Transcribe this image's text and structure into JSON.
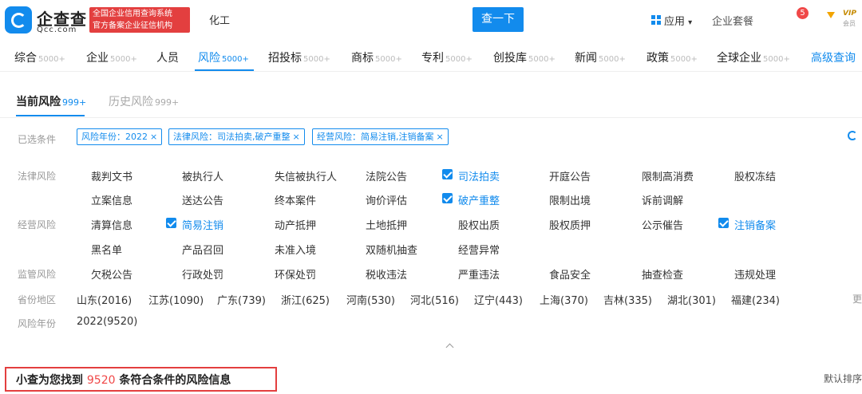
{
  "header": {
    "brand_name": "企查查",
    "brand_domain": "Qcc.com",
    "badge_line1": "全国企业信用查询系统",
    "badge_line2": "官方备案企业征信机构",
    "search_value": "化工",
    "search_button": "查一下",
    "app_label": "应用",
    "app_arrow": "▾",
    "enterprise_pkg": "企业套餐",
    "notif_count": "5",
    "vip_label": "VIP",
    "vip_sub": "会员"
  },
  "category_tabs": [
    {
      "label": "综合",
      "count": "5000+"
    },
    {
      "label": "企业",
      "count": "5000+"
    },
    {
      "label": "人员",
      "count": ""
    },
    {
      "label": "风险",
      "count": "5000+"
    },
    {
      "label": "招投标",
      "count": "5000+"
    },
    {
      "label": "商标",
      "count": "5000+"
    },
    {
      "label": "专利",
      "count": "5000+"
    },
    {
      "label": "创投库",
      "count": "5000+"
    },
    {
      "label": "新闻",
      "count": "5000+"
    },
    {
      "label": "政策",
      "count": "5000+"
    },
    {
      "label": "全球企业",
      "count": "5000+"
    }
  ],
  "advanced_search": "高级查询",
  "sub_tabs": [
    {
      "label": "当前风险",
      "count": "999+"
    },
    {
      "label": "历史风险",
      "count": "999+"
    }
  ],
  "selected": {
    "label": "已选条件",
    "chips": [
      "风险年份：2022",
      "法律风险：司法拍卖,破产重整",
      "经营风险：简易注销,注销备案"
    ],
    "remove": "×"
  },
  "filters": {
    "legal_label": "法律风险",
    "legal": [
      "裁判文书",
      "被执行人",
      "失信被执行人",
      "法院公告",
      "司法拍卖",
      "开庭公告",
      "限制高消费",
      "股权冻结",
      "立案信息",
      "送达公告",
      "终本案件",
      "询价评估",
      "破产重整",
      "限制出境",
      "诉前调解"
    ],
    "operation_label": "经营风险",
    "operation": [
      "清算信息",
      "简易注销",
      "动产抵押",
      "土地抵押",
      "股权出质",
      "股权质押",
      "公示催告",
      "注销备案",
      "黑名单",
      "产品召回",
      "未准入境",
      "双随机抽查",
      "经营异常"
    ],
    "regulatory_label": "监管风险",
    "regulatory": [
      "欠税公告",
      "行政处罚",
      "环保处罚",
      "税收违法",
      "严重违法",
      "食品安全",
      "抽查检查",
      "违规处理"
    ],
    "region_label": "省份地区",
    "regions": [
      "山东(2016)",
      "江苏(1090)",
      "广东(739)",
      "浙江(625)",
      "河南(530)",
      "河北(516)",
      "辽宁(443)",
      "上海(370)",
      "吉林(335)",
      "湖北(301)",
      "福建(234)"
    ],
    "region_more": "更",
    "year_label": "风险年份",
    "years": [
      "2022(9520)"
    ]
  },
  "result": {
    "prefix": "小查为您找到",
    "count": "9520",
    "suffix": "条符合条件的风险信息"
  },
  "sort_label": "默认排序"
}
